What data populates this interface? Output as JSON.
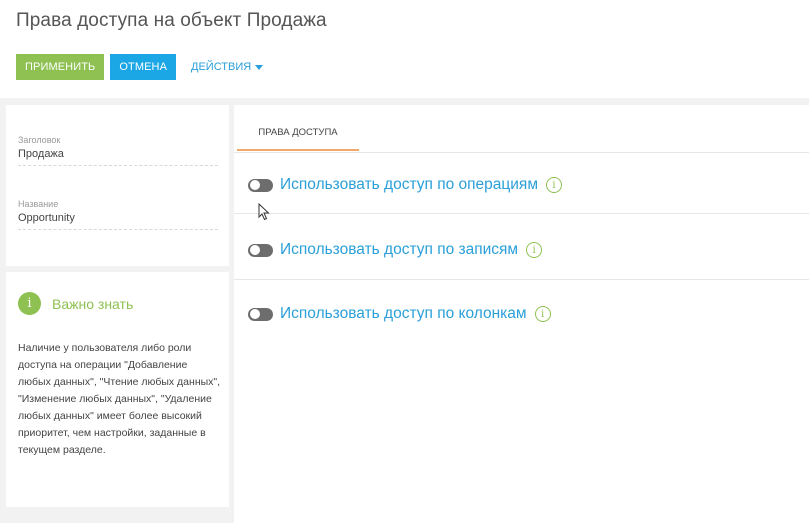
{
  "header": {
    "title": "Права доступа на объект Продажа"
  },
  "toolbar": {
    "apply_label": "ПРИМЕНИТЬ",
    "cancel_label": "ОТМЕНА",
    "actions_label": "ДЕЙСТВИЯ"
  },
  "fields": {
    "caption": {
      "label": "Заголовок",
      "value": "Продажа"
    },
    "name": {
      "label": "Название",
      "value": "Opportunity"
    }
  },
  "info": {
    "title": "Важно знать",
    "icon_char": "i",
    "text": "Наличие у пользователя либо роли доступа на операции \"Добавление любых данных\", \"Чтение любых данных\", \"Изменение любых данных\", \"Удаление любых данных\" имеет более высокий приоритет, чем настройки, заданные в текущем разделе."
  },
  "tabs": [
    {
      "label": "ПРАВА ДОСТУПА"
    }
  ],
  "access_options": [
    {
      "label": "Использовать доступ по операциям",
      "enabled": false
    },
    {
      "label": "Использовать доступ по записям",
      "enabled": false
    },
    {
      "label": "Использовать доступ по колонкам",
      "enabled": false
    }
  ],
  "colors": {
    "apply": "#8ec152",
    "cancel": "#1ba7e5",
    "link": "#2a9fd8",
    "tab_underline": "#f0a96a",
    "toggle_off": "#6d6d6d"
  }
}
